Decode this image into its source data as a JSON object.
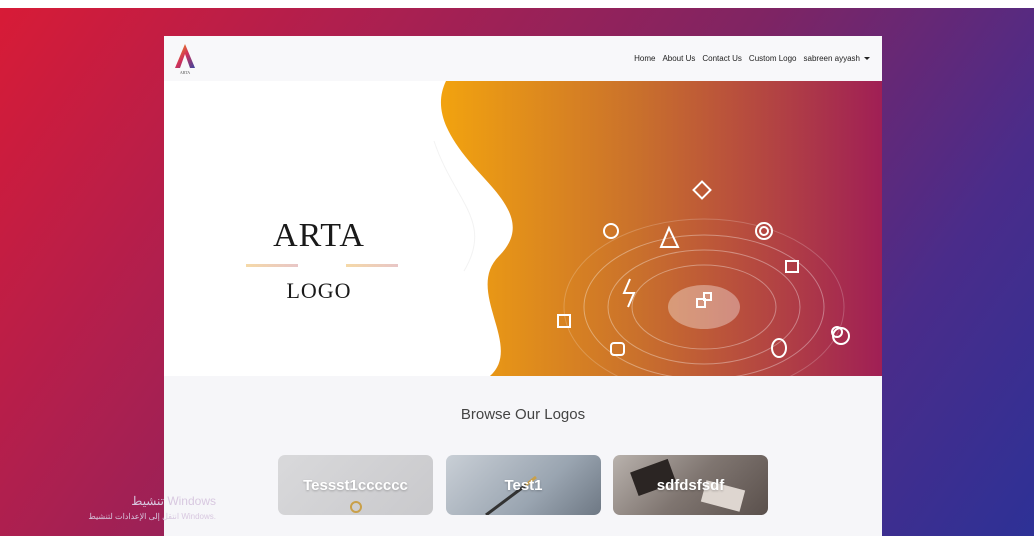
{
  "navbar": {
    "brand_text": "ARTA",
    "links": [
      "Home",
      "About Us",
      "Contact Us",
      "Custom Logo"
    ],
    "user": "sabreen ayyash"
  },
  "hero": {
    "title": "ARTA",
    "subtitle": "LOGO"
  },
  "browse": {
    "heading": "Browse Our Logos",
    "cards": [
      "Tessst1cccccc",
      "Test1",
      "sdfdsfsdf"
    ]
  },
  "watermark": {
    "line1": "تنشيط Windows",
    "line2": "انتقل إلى الإعدادات لتنشيط Windows."
  },
  "colors": {
    "hero_orange": "#f2a30f",
    "hero_magenta": "#a01f55"
  }
}
